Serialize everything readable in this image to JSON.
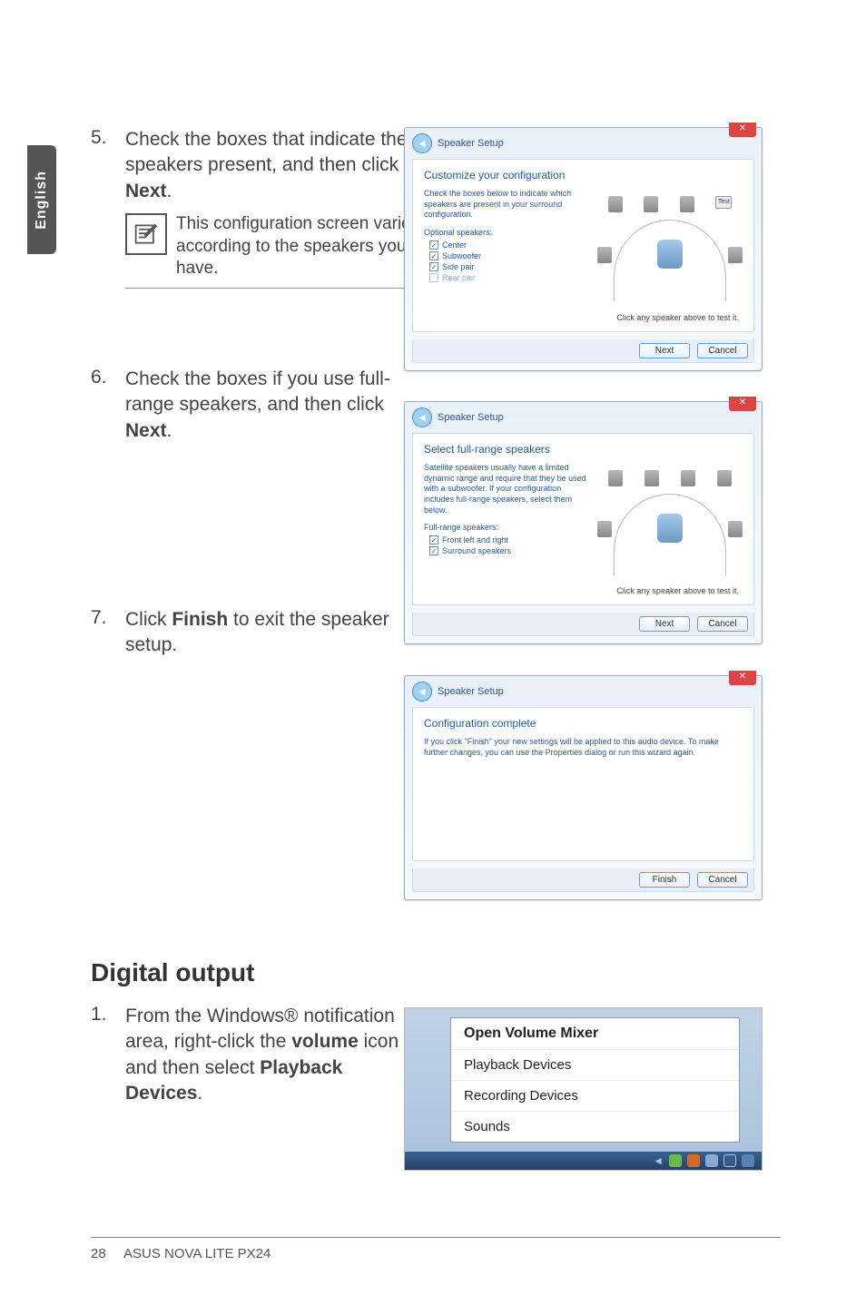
{
  "sideTab": "English",
  "steps": {
    "s5": {
      "num": "5.",
      "text_a": "Check the boxes that indicate the speakers present, and then click ",
      "bold": "Next",
      "text_b": "."
    },
    "note5": "This configuration screen varies according to the speakers you have.",
    "s6": {
      "num": "6.",
      "text_a": "Check the boxes if you use full-range speakers, and then click ",
      "bold": "Next",
      "text_b": "."
    },
    "s7": {
      "num": "7.",
      "text_a": "Click ",
      "bold": "Finish",
      "text_b": " to exit the speaker setup."
    }
  },
  "dialogs": {
    "d1": {
      "title": "Speaker Setup",
      "heading": "Customize your configuration",
      "desc": "Check the boxes below to indicate which speakers are present in your surround configuration.",
      "sub": "Optional speakers:",
      "opts": [
        {
          "label": "Center",
          "checked": true,
          "disabled": false
        },
        {
          "label": "Subwoofer",
          "checked": true,
          "disabled": false
        },
        {
          "label": "Side pair",
          "checked": true,
          "disabled": false
        },
        {
          "label": "Rear pair",
          "checked": false,
          "disabled": true
        }
      ],
      "testLabel": "Test",
      "hint": "Click any speaker above to test it.",
      "btnNext": "Next",
      "btnCancel": "Cancel"
    },
    "d2": {
      "title": "Speaker Setup",
      "heading": "Select full-range speakers",
      "desc": "Satellite speakers usually have a limited dynamic range and require that they be used with a subwoofer. If your configuration includes full-range speakers, select them below.",
      "sub": "Full-range speakers:",
      "opts": [
        {
          "label": "Front left and right",
          "checked": true
        },
        {
          "label": "Surround speakers",
          "checked": true
        }
      ],
      "hint": "Click any speaker above to test it.",
      "btnNext": "Next",
      "btnCancel": "Cancel"
    },
    "d3": {
      "title": "Speaker Setup",
      "heading": "Configuration complete",
      "desc": "If you click \"Finish\" your new settings will be applied to this audio device. To make further changes, you can use the Properties dialog or run this wizard again.",
      "btnFinish": "Finish",
      "btnCancel": "Cancel"
    }
  },
  "digitalOutput": {
    "heading": "Digital output",
    "step1": {
      "num": "1.",
      "text_a": "From the Windows® notification area, right-click the ",
      "bold1": "volume",
      "text_b": " icon ",
      "text_c": " and then select ",
      "bold2": "Playback Devices",
      "text_d": "."
    },
    "menu": [
      "Open Volume Mixer",
      "Playback Devices",
      "Recording Devices",
      "Sounds"
    ]
  },
  "footer": {
    "page": "28",
    "product": "ASUS NOVA LITE PX24"
  }
}
